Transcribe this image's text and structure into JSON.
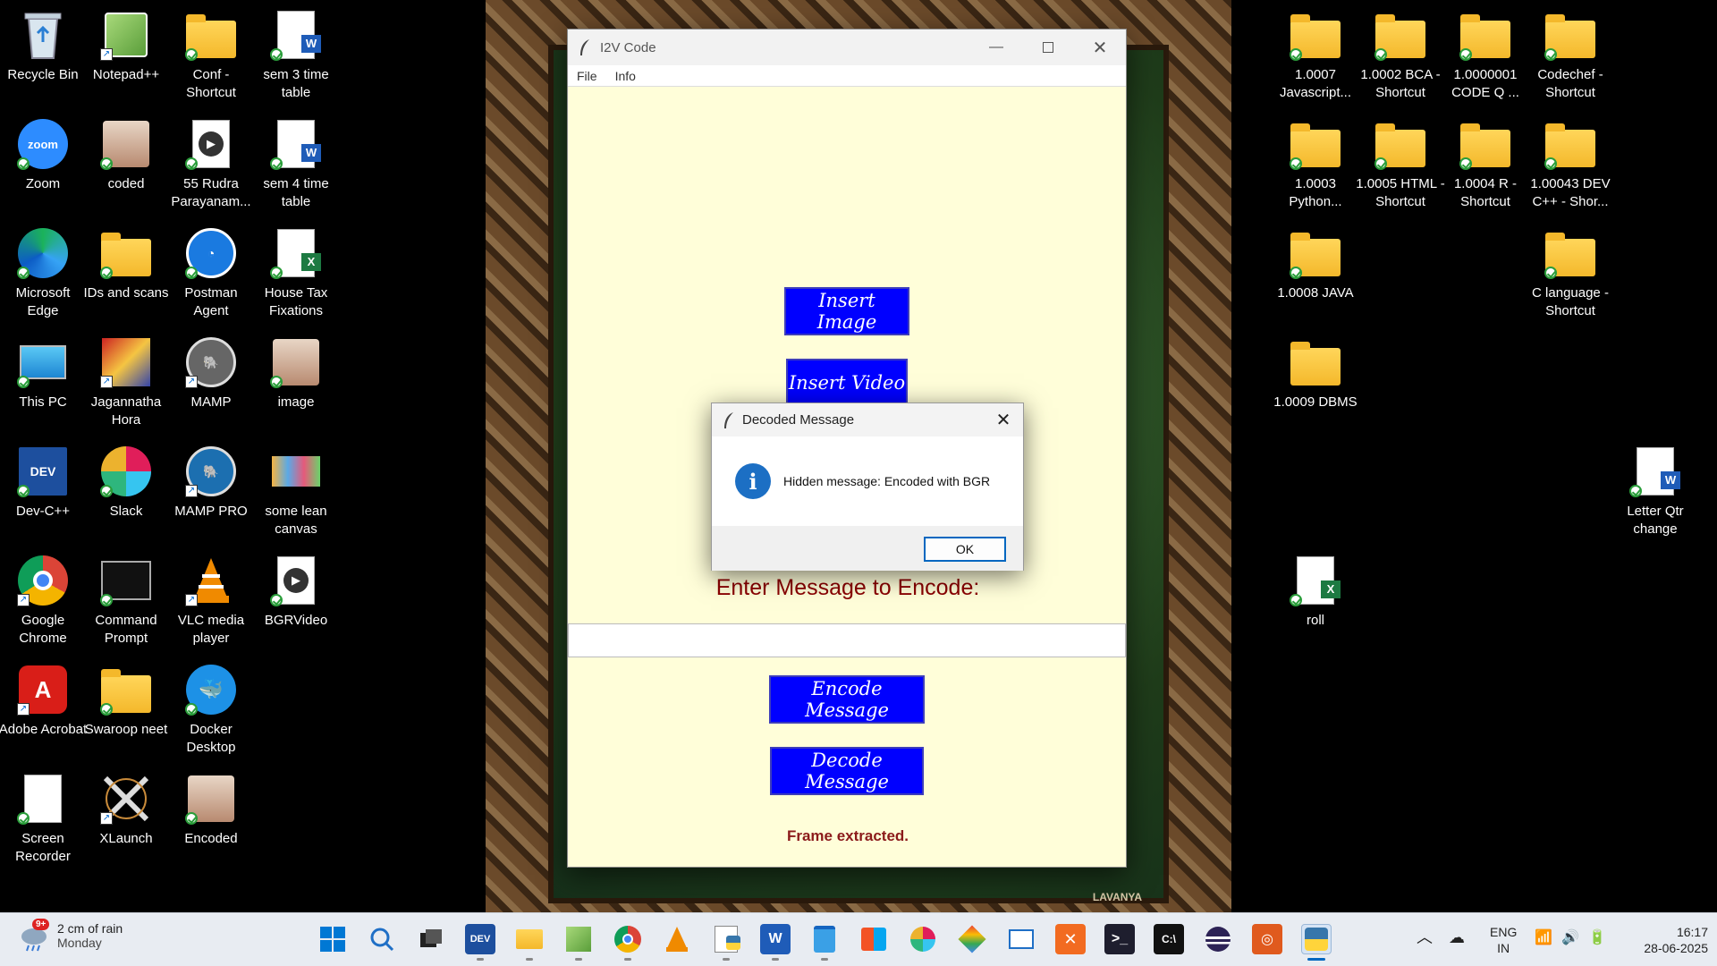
{
  "desktop_left": [
    {
      "label": "Recycle Bin"
    },
    {
      "label": "Notepad++"
    },
    {
      "label": "Conf - Shortcut"
    },
    {
      "label": "sem 3 time table"
    },
    {
      "label": "Zoom"
    },
    {
      "label": "coded"
    },
    {
      "label": "55 Rudra Parayanam..."
    },
    {
      "label": "sem 4 time table"
    },
    {
      "label": "Microsoft Edge"
    },
    {
      "label": "IDs and scans"
    },
    {
      "label": "Postman Agent"
    },
    {
      "label": "House Tax Fixations"
    },
    {
      "label": "This PC"
    },
    {
      "label": "Jagannatha Hora"
    },
    {
      "label": "MAMP"
    },
    {
      "label": "image"
    },
    {
      "label": "Dev-C++"
    },
    {
      "label": "Slack"
    },
    {
      "label": "MAMP PRO"
    },
    {
      "label": "some lean canvas"
    },
    {
      "label": "Google Chrome"
    },
    {
      "label": "Command Prompt"
    },
    {
      "label": "VLC media player"
    },
    {
      "label": "BGRVideo"
    },
    {
      "label": "Adobe Acrobat"
    },
    {
      "label": "Swaroop neet"
    },
    {
      "label": "Docker Desktop"
    },
    {
      "label": "Screen Recorder"
    },
    {
      "label": "XLaunch"
    },
    {
      "label": "Encoded"
    }
  ],
  "desktop_right": [
    {
      "label": "1.0007 Javascript..."
    },
    {
      "label": "1.0002 BCA - Shortcut"
    },
    {
      "label": "1.0000001 CODE Q ..."
    },
    {
      "label": "Codechef - Shortcut"
    },
    {
      "label": "1.0003 Python..."
    },
    {
      "label": "1.0005 HTML - Shortcut"
    },
    {
      "label": "1.0004 R - Shortcut"
    },
    {
      "label": "1.00043 DEV C++ - Shor..."
    },
    {
      "label": "1.0008 JAVA"
    },
    {
      "label": "C language - Shortcut"
    },
    {
      "label": "1.0009 DBMS"
    },
    {
      "label": "Letter Qtr change"
    },
    {
      "label": "roll"
    }
  ],
  "wallpaper": {
    "logo": "LAVANYA"
  },
  "app": {
    "title": "I2V Code",
    "menu": [
      "File",
      "Info"
    ],
    "insert_image": "Insert Image",
    "insert_video": "Insert Video",
    "enter_label": "Enter Message to Encode:",
    "message_value": "",
    "encode_button": "Encode Message",
    "decode_button": "Decode Message",
    "status": "Frame extracted."
  },
  "dialog": {
    "title": "Decoded Message",
    "message": "Hidden message: Encoded with BGR",
    "ok_label": "OK"
  },
  "taskbar": {
    "weather_badge": "9+",
    "weather_line1": "2 cm of rain",
    "weather_line2": "Monday",
    "lang_line1": "ENG",
    "lang_line2": "IN",
    "time": "16:17",
    "date": "28-06-2025",
    "colors": {
      "accent": "#0067c0",
      "app_bg": "#fffed9",
      "button_blue": "#0000ff",
      "label_red": "#8b0000"
    }
  }
}
